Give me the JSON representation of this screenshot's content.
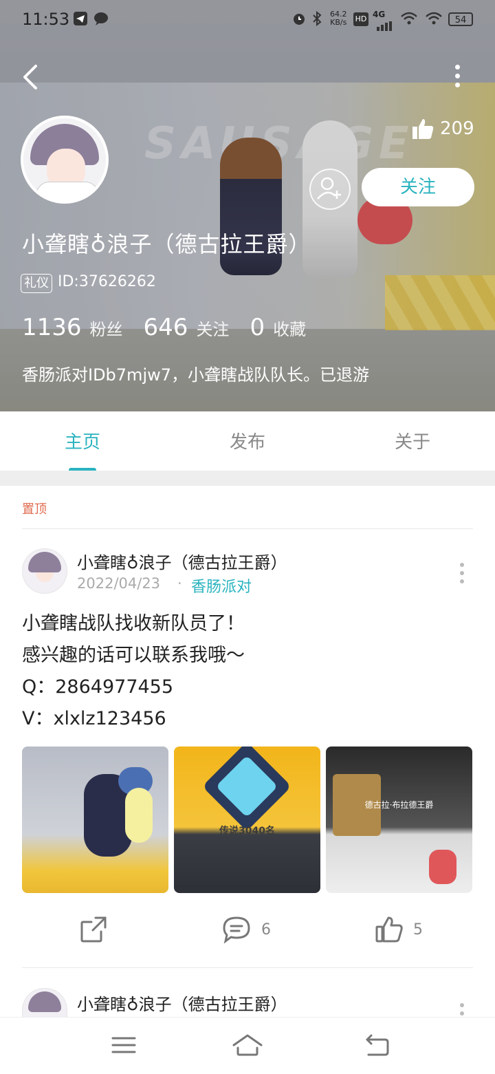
{
  "status_bar": {
    "time": "11:53",
    "net_speed": "64.2",
    "net_unit": "KB/s",
    "hd": "HD",
    "network": "4G",
    "battery": "54"
  },
  "profile": {
    "likes": "209",
    "follow_label": "关注",
    "nickname": "小聋瞎♁浪子（德古拉王爵）",
    "badge": "礼仪",
    "uid": "ID:37626262",
    "stats": [
      {
        "num": "1136",
        "label": "粉丝"
      },
      {
        "num": "646",
        "label": "关注"
      },
      {
        "num": "0",
        "label": "收藏"
      }
    ],
    "bio": "香肠派对IDb7mjw7，小聋瞎战队队长。已退游",
    "banner_watermark": "SAUSAGE"
  },
  "tabs": [
    "主页",
    "发布",
    "关于"
  ],
  "post": {
    "pinned_label": "置顶",
    "author": "小聋瞎♁浪子（德古拉王爵）",
    "date": "2022/04/23",
    "category": "香肠派对",
    "lines": [
      "小聋瞎战队找收新队员了！",
      "感兴趣的话可以联系我哦～",
      "Q：2864977455",
      "V：xlxlz123456"
    ],
    "image_captions": [
      "",
      "传说3040名",
      "德古拉·布拉德王爵"
    ],
    "comments": "6",
    "likes": "5"
  },
  "post2": {
    "author": "小聋瞎♁浪子（德古拉王爵）"
  },
  "colors": {
    "accent": "#2ab3bf",
    "pinned": "#e06a4d"
  }
}
